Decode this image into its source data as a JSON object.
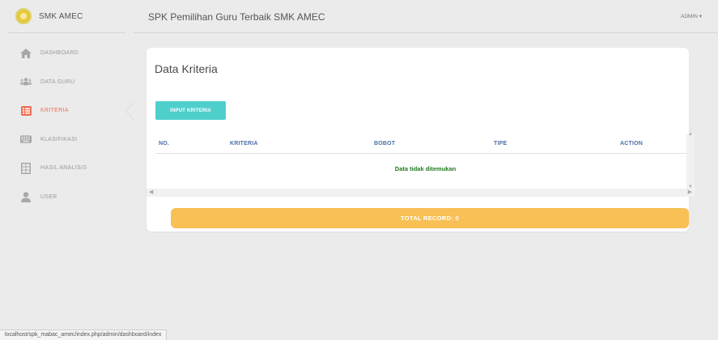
{
  "brand": {
    "name": "SMK AMEC"
  },
  "topbar": {
    "title": "SPK Pemilihan Guru Terbaik SMK AMEC",
    "user": "ADMIN ▾"
  },
  "sidebar": {
    "items": [
      {
        "label": "DASHBOARD",
        "icon": "home-icon",
        "active": false
      },
      {
        "label": "DATA GURU",
        "icon": "users-icon",
        "active": false
      },
      {
        "label": "KRITERIA",
        "icon": "list-icon",
        "active": true
      },
      {
        "label": "KLASIFIKASI",
        "icon": "keyboard-icon",
        "active": false
      },
      {
        "label": "HASIL ANALISIS",
        "icon": "grid-icon",
        "active": false
      },
      {
        "label": "USER",
        "icon": "user-icon",
        "active": false
      }
    ]
  },
  "main": {
    "title": "Data Kriteria",
    "input_button": "INPUT KRITERIA",
    "table": {
      "headers": [
        "NO.",
        "KRITERIA",
        "BOBOT",
        "TIPE",
        "ACTION"
      ],
      "empty_message": "Data tidak ditemukan"
    },
    "total_label": "TOTAL RECORD: 0"
  },
  "statusbar": {
    "url": "localhost/spk_mabac_amec/index.php/admin/dashboard/index"
  },
  "colors": {
    "accent_cyan": "#4fcfcc",
    "active_nav": "#ef6e55",
    "total_bar": "#f8c055",
    "header_text": "#4c6ea8",
    "empty_text": "#1f7a1f"
  }
}
